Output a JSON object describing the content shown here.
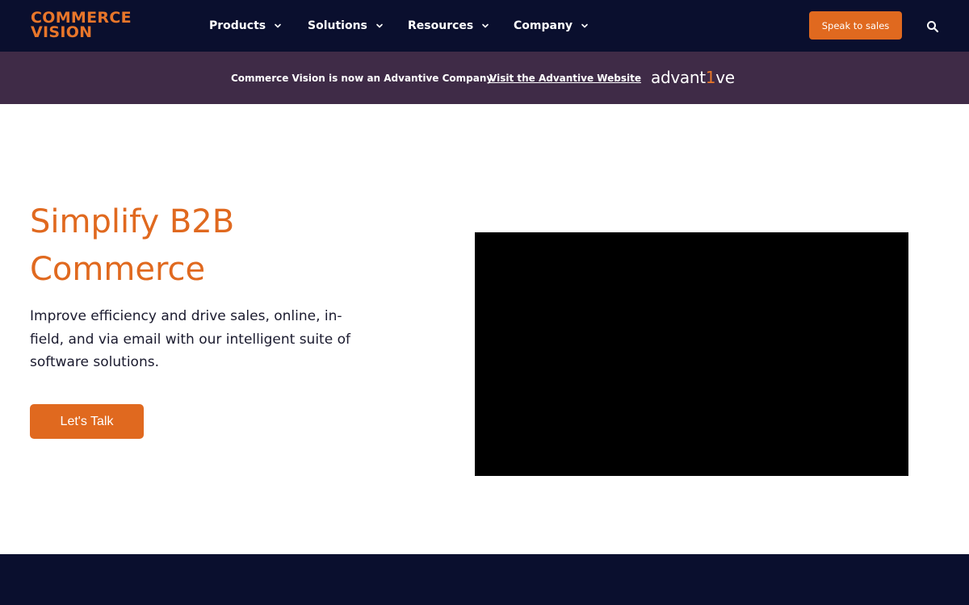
{
  "header": {
    "logo_line1": "COMMERCE",
    "logo_line2": "VISION",
    "nav": [
      {
        "label": "Products"
      },
      {
        "label": "Solutions"
      },
      {
        "label": "Resources"
      },
      {
        "label": "Company"
      }
    ],
    "cta_label": "Speak to sales",
    "search_icon": "search-icon"
  },
  "banner": {
    "text": "Commerce Vision is now an Advantive Company.",
    "link_text": "Visit the Advantive Website",
    "partner_logo_a": "advant",
    "partner_logo_one": "1",
    "partner_logo_b": "ve"
  },
  "hero": {
    "title": "Simplify B2B Commerce",
    "subtitle": "Improve efficiency and drive sales, online, in-field, and via email with our intelligent suite of software solutions.",
    "button_label": "Let's Talk"
  },
  "colors": {
    "navy": "#0a0f2e",
    "banner_purple": "#3f2b47",
    "accent_orange": "#e0691f"
  }
}
